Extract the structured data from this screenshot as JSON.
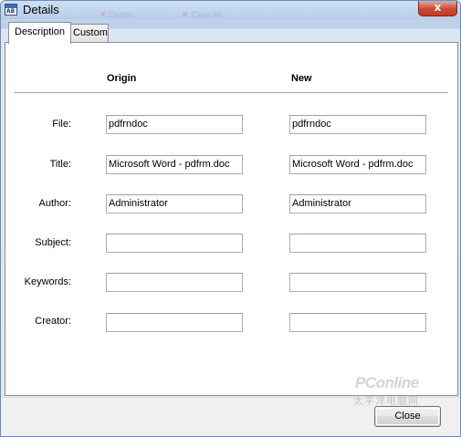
{
  "window": {
    "title": "Details",
    "app_icon_letters": "AB",
    "close_glyph": "x"
  },
  "behind": {
    "item1": "Delete",
    "item2": "Clear All"
  },
  "tabs": [
    {
      "label": "Description",
      "active": true
    },
    {
      "label": "Custom",
      "active": false
    }
  ],
  "columns": {
    "origin": "Origin",
    "new": "New"
  },
  "fields": [
    {
      "label": "File:",
      "origin": "pdfrndoc",
      "new": "pdfrndoc"
    },
    {
      "label": "Title:",
      "origin": "Microsoft Word - pdfrm.doc",
      "new": "Microsoft Word - pdfrm.doc"
    },
    {
      "label": "Author:",
      "origin": "Administrator",
      "new": "Administrator"
    },
    {
      "label": "Subject:",
      "origin": "",
      "new": ""
    },
    {
      "label": "Keywords:",
      "origin": "",
      "new": ""
    },
    {
      "label": "Creator:",
      "origin": "",
      "new": ""
    }
  ],
  "footer": {
    "close_label": "Close"
  },
  "watermark": {
    "brand": "PConline",
    "sub": "太平洋电脑网"
  },
  "colors": {
    "titlebar": "#b9cfe8",
    "close_button": "#c74c35",
    "panel": "#ffffff",
    "footer": "#f0f0f0"
  }
}
